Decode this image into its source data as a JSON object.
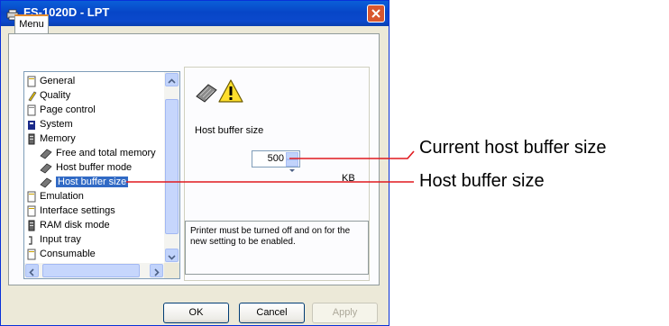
{
  "window": {
    "title": "FS-1020D - LPT"
  },
  "tabs": [
    {
      "label": "Menu"
    }
  ],
  "tree": {
    "items": [
      {
        "label": "General"
      },
      {
        "label": "Quality"
      },
      {
        "label": "Page control"
      },
      {
        "label": "System"
      },
      {
        "label": "Memory"
      },
      {
        "label": "Free and total memory"
      },
      {
        "label": "Host buffer mode"
      },
      {
        "label": "Host buffer size"
      },
      {
        "label": "Emulation"
      },
      {
        "label": "Interface settings"
      },
      {
        "label": "RAM disk mode"
      },
      {
        "label": "Input tray"
      },
      {
        "label": "Consumable"
      }
    ],
    "selected": "Host buffer size"
  },
  "detail": {
    "field_label": "Host buffer size",
    "value": "500",
    "unit": "KB",
    "note": "Printer must be turned off and on for the new setting to be enabled."
  },
  "buttons": {
    "ok": "OK",
    "cancel": "Cancel",
    "apply": "Apply"
  },
  "callouts": {
    "current": "Current host buffer size",
    "size": "Host buffer size"
  },
  "colors": {
    "callout_line": "#e0191e",
    "title_bar": "#0a5fd8",
    "selection": "#316ac5"
  }
}
